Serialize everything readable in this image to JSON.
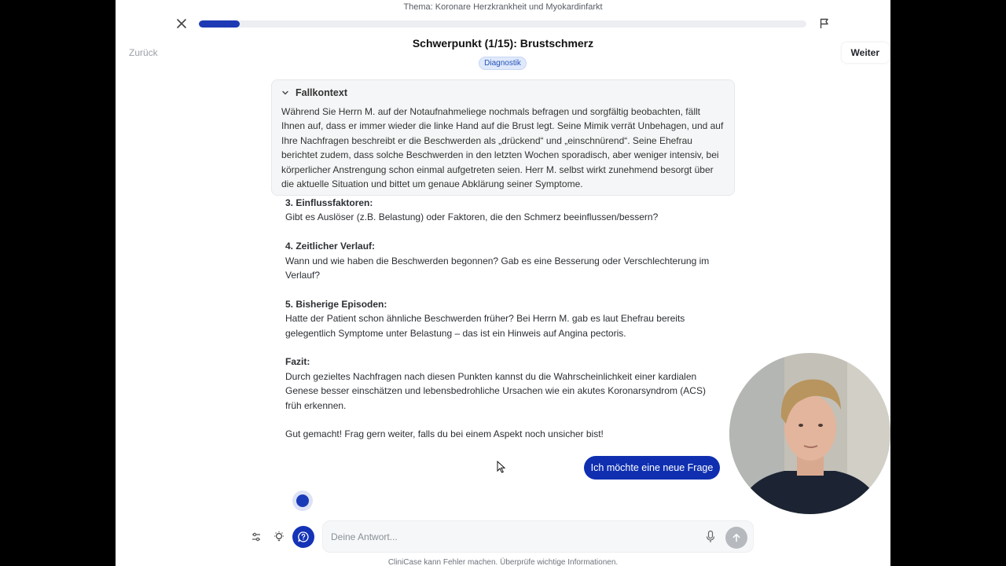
{
  "header": {
    "topic": "Thema: Koronare Herzkrankheit und Myokardinfarkt",
    "progress": 0.067,
    "title": "Schwerpunkt (1/15): Brustschmerz",
    "badge": "Diagnostik",
    "back_label": "Zurück",
    "next_label": "Weiter"
  },
  "context": {
    "title": "Fallkontext",
    "text": "Während Sie Herrn M. auf der Notaufnahmeliege nochmals befragen und sorgfältig beobachten, fällt Ihnen auf, dass er immer wieder die linke Hand auf die Brust legt. Seine Mimik verrät Unbehagen, und auf Ihre Nachfragen beschreibt er die Beschwerden als „drückend“ und „einschnürend“. Seine Ehefrau berichtet zudem, dass solche Beschwerden in den letzten Wochen sporadisch, aber weniger intensiv, bei körperlicher Anstrengung schon einmal aufgetreten seien. Herr M. selbst wirkt zunehmend besorgt über die aktuelle Situation und bittet um genaue Abklärung seiner Symptome."
  },
  "chat": {
    "sections": [
      {
        "heading": "3. Einflussfaktoren:",
        "text": "Gibt es Auslöser (z.B. Belastung) oder Faktoren, die den Schmerz beeinflussen/bessern?"
      },
      {
        "heading": "4. Zeitlicher Verlauf:",
        "text": "Wann und wie haben die Beschwerden begonnen? Gab es eine Besserung oder Verschlechterung im Verlauf?"
      },
      {
        "heading": "5. Bisherige Episoden:",
        "text": "Hatte der Patient schon ähnliche Beschwerden früher? Bei Herrn M. gab es laut Ehefrau bereits gelegentlich Symptome unter Belastung – das ist ein Hinweis auf Angina pectoris."
      },
      {
        "heading": "Fazit:",
        "text": "Durch gezieltes Nachfragen nach diesen Punkten kannst du die Wahrscheinlichkeit einer kardialen Genese besser einschätzen und lebensbedrohliche Ursachen wie ein akutes Koronarsyndrom (ACS) früh erkennen."
      }
    ],
    "closing": "Gut gemacht! Frag gern weiter, falls du bei einem Aspekt noch unsicher bist!",
    "user_message": "Ich möchte eine neue Frage"
  },
  "input": {
    "placeholder": "Deine Antwort..."
  },
  "footer": {
    "disclaimer": "CliniCase kann Fehler machen. Überprüfe wichtige Informationen."
  },
  "colors": {
    "accent": "#1433b7",
    "user_bubble": "#0f2fb0",
    "badge_bg": "#dfe9fb",
    "badge_text": "#2553b7"
  },
  "icons": [
    "close-icon",
    "flag-icon",
    "chevron-down-icon",
    "settings-sliders-icon",
    "lightbulb-icon",
    "question-bubble-icon",
    "microphone-icon",
    "arrow-up-icon",
    "mouse-cursor-icon"
  ]
}
